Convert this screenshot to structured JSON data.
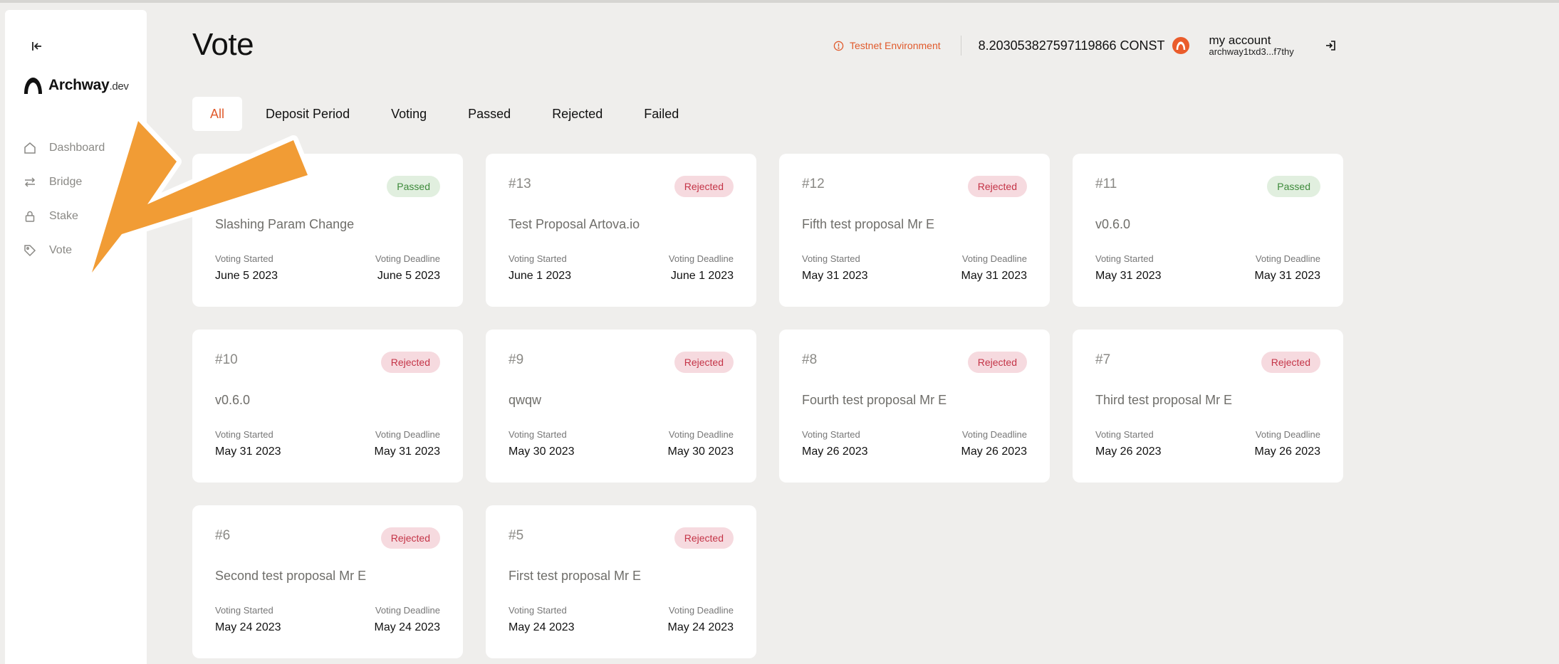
{
  "sidebar": {
    "logo_text": "Archway",
    "logo_suffix": ".dev",
    "items": [
      {
        "label": "Dashboard",
        "icon": "home-icon"
      },
      {
        "label": "Bridge",
        "icon": "swap-icon"
      },
      {
        "label": "Stake",
        "icon": "lock-icon"
      },
      {
        "label": "Vote",
        "icon": "tag-icon"
      }
    ]
  },
  "header": {
    "title": "Vote",
    "environment": "Testnet Environment",
    "balance": "8.203053827597119866 CONST",
    "account_name": "my account",
    "account_address": "archway1txd3...f7thy"
  },
  "tabs": [
    "All",
    "Deposit Period",
    "Voting",
    "Passed",
    "Rejected",
    "Failed"
  ],
  "active_tab": "All",
  "colors": {
    "accent": "#e05a2c",
    "passed_bg": "#e1efdf",
    "passed_text": "#3d8a3a",
    "rejected_bg": "#f6dadf",
    "rejected_text": "#c43447",
    "arrow": "#f19c35"
  },
  "proposals": [
    {
      "id": "",
      "status": "Passed",
      "title": "Slashing Param Change",
      "start_label": "Voting Started",
      "start": "June 5 2023",
      "deadline_label": "Voting Deadline",
      "deadline": "June 5 2023"
    },
    {
      "id": "#13",
      "status": "Rejected",
      "title": "Test Proposal Artova.io",
      "start_label": "Voting Started",
      "start": "June 1 2023",
      "deadline_label": "Voting Deadline",
      "deadline": "June 1 2023"
    },
    {
      "id": "#12",
      "status": "Rejected",
      "title": "Fifth test proposal Mr E",
      "start_label": "Voting Started",
      "start": "May 31 2023",
      "deadline_label": "Voting Deadline",
      "deadline": "May 31 2023"
    },
    {
      "id": "#11",
      "status": "Passed",
      "title": "v0.6.0",
      "start_label": "Voting Started",
      "start": "May 31 2023",
      "deadline_label": "Voting Deadline",
      "deadline": "May 31 2023"
    },
    {
      "id": "#10",
      "status": "Rejected",
      "title": "v0.6.0",
      "start_label": "Voting Started",
      "start": "May 31 2023",
      "deadline_label": "Voting Deadline",
      "deadline": "May 31 2023"
    },
    {
      "id": "#9",
      "status": "Rejected",
      "title": "qwqw",
      "start_label": "Voting Started",
      "start": "May 30 2023",
      "deadline_label": "Voting Deadline",
      "deadline": "May 30 2023"
    },
    {
      "id": "#8",
      "status": "Rejected",
      "title": "Fourth test proposal Mr E",
      "start_label": "Voting Started",
      "start": "May 26 2023",
      "deadline_label": "Voting Deadline",
      "deadline": "May 26 2023"
    },
    {
      "id": "#7",
      "status": "Rejected",
      "title": "Third test proposal Mr E",
      "start_label": "Voting Started",
      "start": "May 26 2023",
      "deadline_label": "Voting Deadline",
      "deadline": "May 26 2023"
    },
    {
      "id": "#6",
      "status": "Rejected",
      "title": "Second test proposal Mr E",
      "start_label": "Voting Started",
      "start": "May 24 2023",
      "deadline_label": "Voting Deadline",
      "deadline": "May 24 2023"
    },
    {
      "id": "#5",
      "status": "Rejected",
      "title": "First test proposal Mr E",
      "start_label": "Voting Started",
      "start": "May 24 2023",
      "deadline_label": "Voting Deadline",
      "deadline": "May 24 2023"
    }
  ]
}
